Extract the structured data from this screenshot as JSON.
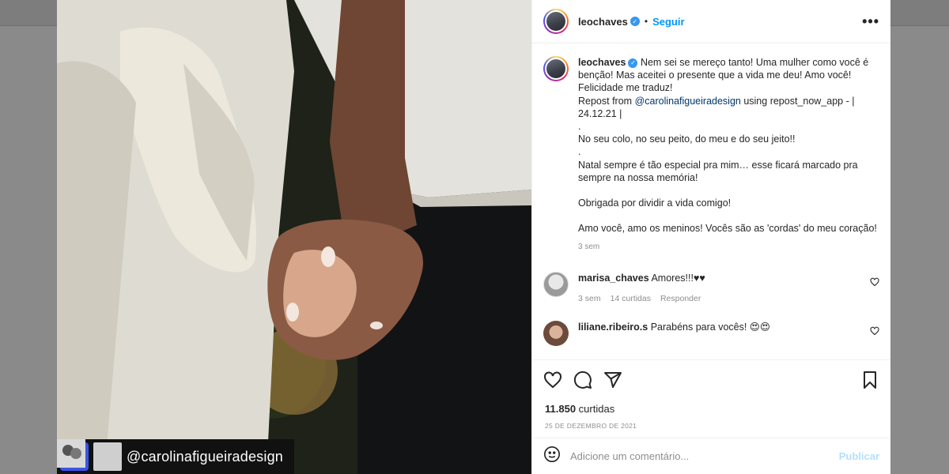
{
  "post": {
    "author": "leochaves",
    "verified": true,
    "follow_label": "Seguir",
    "more_label": "•••",
    "caption_lines": [
      "Nem sei se mereço tanto! Uma mulher como você é",
      "benção! Mas aceitei o presente que a vida me deu! Amo você!",
      "Felicidade me traduz!",
      "Repost from ",
      "24.12.21 |",
      ".",
      "No seu colo, no seu peito, do meu e do seu jeito!!",
      ".",
      "Natal sempre é tão especial pra mim… esse ficará marcado pra",
      "sempre na nossa memória!",
      "",
      "Obrigada por dividir a vida comigo!",
      "",
      "Amo você, amo os meninos! Vocês são as 'cordas' do meu coração!"
    ],
    "repost_mention": "@carolinafigueiradesign",
    "repost_suffix": " using repost_now_app - |",
    "caption_time": "3 sem",
    "likes_count": "11.850",
    "likes_label": "curtidas",
    "date": "25 DE DEZEMBRO DE 2021"
  },
  "photo": {
    "repost_username": "@carolinafigueiradesign"
  },
  "comments": [
    {
      "user": "marisa_chaves",
      "text": "Amores!!!♥♥",
      "time": "3 sem",
      "likes": "14 curtidas",
      "reply": "Responder"
    },
    {
      "user": "liliane.ribeiro.s",
      "text": "Parabéns para vocês! 😍😍"
    }
  ],
  "add_comment": {
    "placeholder": "Adicione um comentário...",
    "publish_label": "Publicar"
  },
  "colors": {
    "link_blue": "#0095f6",
    "mention": "#00376b",
    "repost_badge": "#3b55e6",
    "muted": "#8e8e8e"
  },
  "icons": [
    "verified-badge-icon",
    "more-icon",
    "heart-icon",
    "comment-icon",
    "share-icon",
    "bookmark-icon",
    "emoji-icon",
    "repost-icon"
  ]
}
